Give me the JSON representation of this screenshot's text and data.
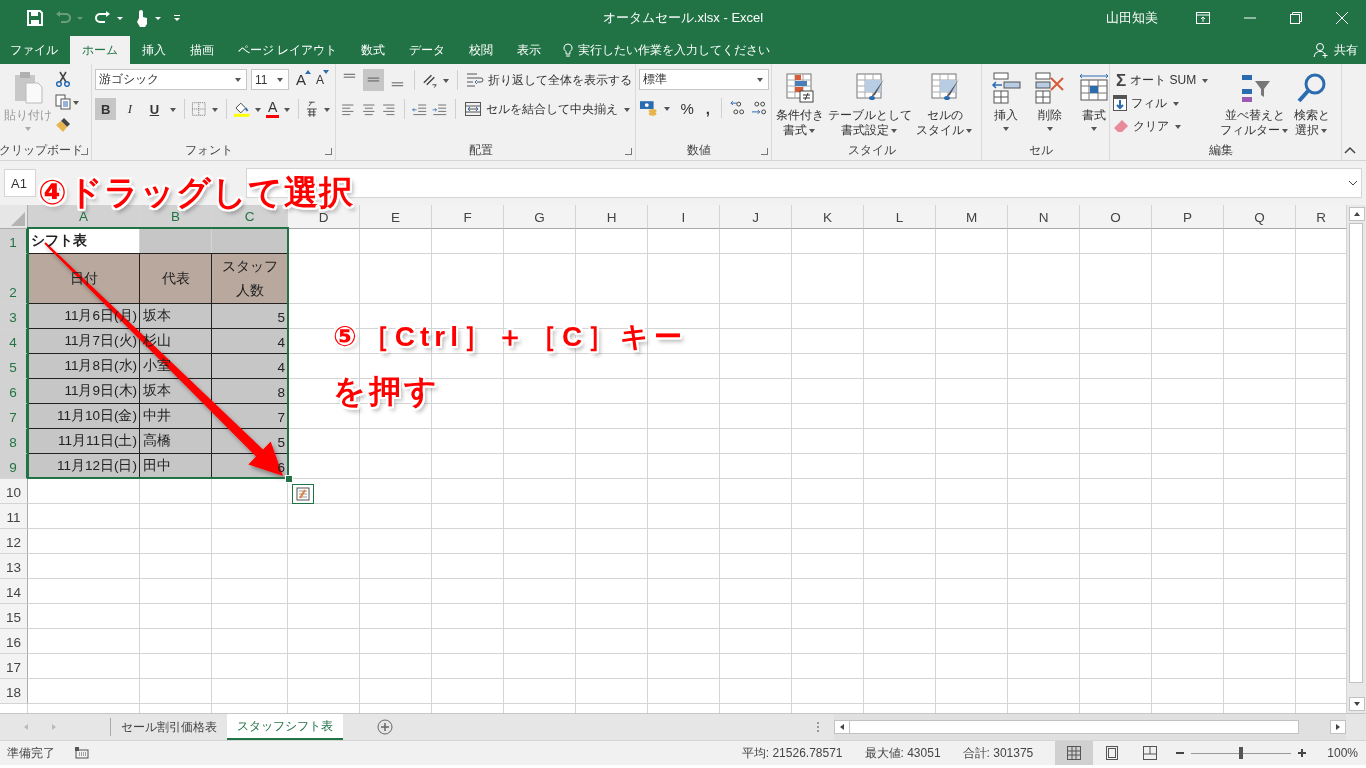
{
  "title_bar": {
    "title": "オータムセール.xlsx  -  Excel",
    "user": "山田知美"
  },
  "tabs": [
    {
      "label": "ファイル",
      "selected": false
    },
    {
      "label": "ホーム",
      "selected": true
    },
    {
      "label": "挿入",
      "selected": false
    },
    {
      "label": "描画",
      "selected": false
    },
    {
      "label": "ページ レイアウト",
      "selected": false
    },
    {
      "label": "数式",
      "selected": false
    },
    {
      "label": "データ",
      "selected": false
    },
    {
      "label": "校閲",
      "selected": false
    },
    {
      "label": "表示",
      "selected": false
    }
  ],
  "tell_me": {
    "placeholder": "実行したい作業を入力してください"
  },
  "share": "共有",
  "clipboard": {
    "label": "クリップボード",
    "paste": "貼り付け",
    "paste_disabled": true
  },
  "font": {
    "label": "フォント",
    "name": "游ゴシック",
    "size": "11",
    "grow": "A",
    "shrink": "A",
    "font_color": "A",
    "styles": [
      {
        "label": "B",
        "selected": true
      },
      {
        "label": "I",
        "selected": false
      },
      {
        "label": "U",
        "selected": false
      }
    ]
  },
  "alignment": {
    "label": "配置",
    "wrap": "折り返して全体を表示する",
    "merge": "セルを結合して中央揃え",
    "vertical": [
      {
        "selected": false
      },
      {
        "selected": true
      },
      {
        "selected": false
      }
    ]
  },
  "number": {
    "label": "数値",
    "format": "標準",
    "percent": "%",
    "comma": ","
  },
  "styles_group": {
    "label": "スタイル",
    "buttons": [
      {
        "lines": [
          "条件付き",
          "書式"
        ],
        "menu": true
      },
      {
        "lines": [
          "テーブルとして",
          "書式設定"
        ],
        "menu": true
      },
      {
        "lines": [
          "セルの",
          "スタイル"
        ],
        "menu": true
      }
    ]
  },
  "cells_group": {
    "label": "セル",
    "buttons": [
      {
        "lines": [
          "挿入"
        ],
        "menu": true
      },
      {
        "lines": [
          "削除"
        ],
        "menu": true
      },
      {
        "lines": [
          "書式"
        ],
        "menu": true
      }
    ]
  },
  "editing": {
    "label": "編集",
    "sigma": "Σ",
    "autosum": "オート SUM",
    "fill": "フィル",
    "clear": "クリア",
    "buttons": [
      {
        "lines": [
          "並べ替えと",
          "フィルター"
        ],
        "menu": true
      },
      {
        "lines": [
          "検索と",
          "選択"
        ],
        "menu": true
      }
    ]
  },
  "formula_bar": {
    "name_box": "A1"
  },
  "columns": [
    {
      "label": "A",
      "selected": true
    },
    {
      "label": "B",
      "selected": true
    },
    {
      "label": "C",
      "selected": true
    },
    {
      "label": "D",
      "selected": false
    },
    {
      "label": "E",
      "selected": false
    },
    {
      "label": "F",
      "selected": false
    },
    {
      "label": "G",
      "selected": false
    },
    {
      "label": "H",
      "selected": false
    },
    {
      "label": "I",
      "selected": false
    },
    {
      "label": "J",
      "selected": false
    },
    {
      "label": "K",
      "selected": false
    },
    {
      "label": "L",
      "selected": false
    },
    {
      "label": "M",
      "selected": false
    },
    {
      "label": "N",
      "selected": false
    },
    {
      "label": "O",
      "selected": false
    },
    {
      "label": "P",
      "selected": false
    },
    {
      "label": "Q",
      "selected": false
    },
    {
      "label": "R",
      "selected": false
    }
  ],
  "rows": [
    {
      "label": "1",
      "selected": true
    },
    {
      "label": "2",
      "selected": true
    },
    {
      "label": "3",
      "selected": true
    },
    {
      "label": "4",
      "selected": true
    },
    {
      "label": "5",
      "selected": true
    },
    {
      "label": "6",
      "selected": true
    },
    {
      "label": "7",
      "selected": true
    },
    {
      "label": "8",
      "selected": true
    },
    {
      "label": "9",
      "selected": true
    },
    {
      "label": "10",
      "selected": false
    },
    {
      "label": "11",
      "selected": false
    },
    {
      "label": "12",
      "selected": false
    },
    {
      "label": "13",
      "selected": false
    },
    {
      "label": "14",
      "selected": false
    },
    {
      "label": "15",
      "selected": false
    },
    {
      "label": "16",
      "selected": false
    },
    {
      "label": "17",
      "selected": false
    },
    {
      "label": "18",
      "selected": false
    }
  ],
  "title_cell": "シフト表",
  "header_cells": [
    [
      "日付"
    ],
    [
      "代表"
    ],
    [
      "スタッフ",
      "人数"
    ]
  ],
  "data_rows": [
    {
      "date": "11月6日(月)",
      "rep": "坂本",
      "staff": "5"
    },
    {
      "date": "11月7日(火)",
      "rep": "杉山",
      "staff": "4"
    },
    {
      "date": "11月8日(水)",
      "rep": "小室",
      "staff": "4"
    },
    {
      "date": "11月9日(木)",
      "rep": "坂本",
      "staff": "8"
    },
    {
      "date": "11月10日(金)",
      "rep": "中井",
      "staff": "7"
    },
    {
      "date": "11月11日(土)",
      "rep": "高橋",
      "staff": "5"
    },
    {
      "date": "11月12日(日)",
      "rep": "田中",
      "staff": "6"
    }
  ],
  "annotations": [
    {
      "text": "④ドラッグして選択"
    },
    {
      "text": "⑤［Ctrl］＋［C］キー"
    },
    {
      "text": "を押す"
    }
  ],
  "sheet_tabs": [
    {
      "label": "セール割引価格表",
      "selected": false
    },
    {
      "label": "スタッフシフト表",
      "selected": true
    }
  ],
  "status_bar": {
    "ready": "準備完了",
    "average": "平均: 21526.78571",
    "max": "最大値: 43051",
    "sum": "合計: 301375",
    "views": [
      {
        "selected": true
      },
      {
        "selected": false
      },
      {
        "selected": false
      }
    ],
    "zoom": {
      "level": 0.5,
      "label": "100%"
    }
  }
}
